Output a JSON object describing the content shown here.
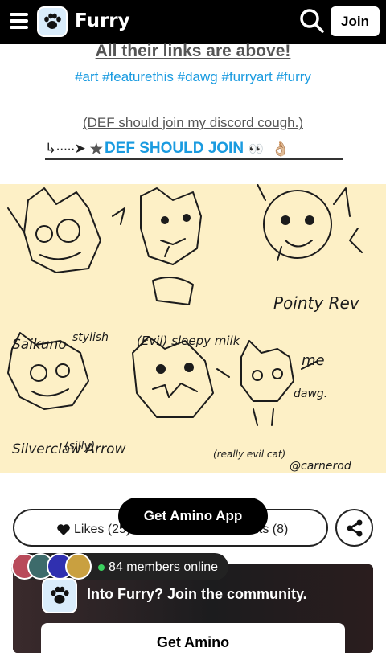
{
  "header": {
    "app_name": "Furry",
    "join_label": "Join"
  },
  "post": {
    "links_line": "All their links are above!",
    "tags_line": "#art #featurethis #dawg #furryart #furry",
    "discord_line": "(DEF should join my discord cough.)",
    "join_link": "DEF SHOULD JOIN",
    "eyes": "👀",
    "ok_emoji": "👌🏼"
  },
  "artwork": {
    "labels": [
      "Pointy Rev",
      "Saikuno",
      "stylish",
      "(Evil) sleepy milk",
      "me",
      "dawg.",
      "(silly)",
      "Silverclaw Arrow",
      "(really evil cat)",
      "@carnerod"
    ]
  },
  "actions": {
    "likes_label": "Likes (25)",
    "comments_label": "nts (8)"
  },
  "get_app_label": "Get Amino App",
  "community": {
    "online_text": "84 members online",
    "promo_text": "Into Furry? Join the community.",
    "promo_button": "Get Amino"
  },
  "colors": {
    "accent": "#1a9be0",
    "art_bg": "#fdf0c6",
    "online_dot": "#3bd15f"
  }
}
